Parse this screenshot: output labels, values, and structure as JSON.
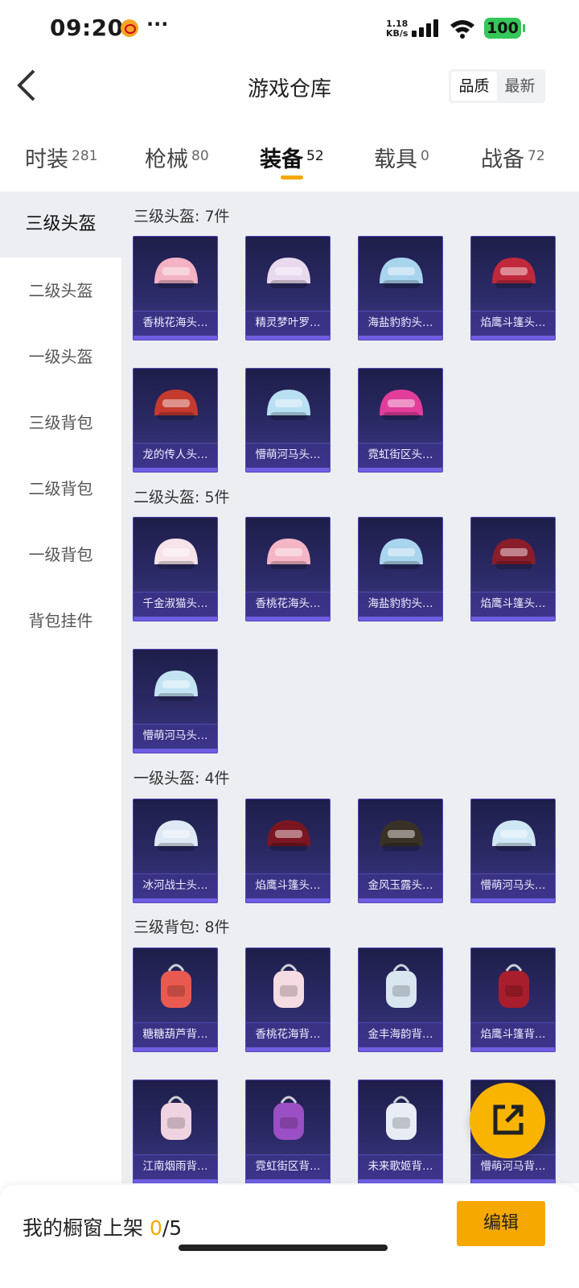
{
  "status_bar": {
    "time": "09:20",
    "more": "···",
    "net_speed_value": "1.18",
    "net_speed_unit": "KB/s",
    "battery": "100"
  },
  "header": {
    "title": "游戏仓库",
    "sort_quality": "品质",
    "sort_latest": "最新"
  },
  "tabs": [
    {
      "label": "时装",
      "count": "281"
    },
    {
      "label": "枪械",
      "count": "80"
    },
    {
      "label": "装备",
      "count": "52"
    },
    {
      "label": "载具",
      "count": "0"
    },
    {
      "label": "战备",
      "count": "72"
    }
  ],
  "sidebar": {
    "items": [
      "三级头盔",
      "二级头盔",
      "一级头盔",
      "三级背包",
      "二级背包",
      "一级背包",
      "背包挂件"
    ]
  },
  "sections": [
    {
      "title": "三级头盔: 7件",
      "items": [
        "香桃花海头…",
        "精灵梦叶罗…",
        "海盐豹豹头…",
        "焰鹰斗篷头…",
        "龙的传人头…",
        "懵萌河马头…",
        "霓虹街区头…"
      ]
    },
    {
      "title": "二级头盔: 5件",
      "items": [
        "千金淑猫头…",
        "香桃花海头…",
        "海盐豹豹头…",
        "焰鹰斗篷头…",
        "懵萌河马头…"
      ]
    },
    {
      "title": "一级头盔: 4件",
      "items": [
        "冰河战士头…",
        "焰鹰斗篷头…",
        "金风玉露头…",
        "懵萌河马头…"
      ]
    },
    {
      "title": "三级背包: 8件",
      "items": [
        "糖糖葫芦背…",
        "香桃花海背…",
        "金丰海韵背…",
        "焰鹰斗篷背…",
        "江南烟雨背…",
        "霓虹街区背…",
        "未来歌姬背…",
        "懵萌河马背…"
      ]
    }
  ],
  "bottom": {
    "label": "我的橱窗上架",
    "current": "0",
    "total": "/5",
    "edit_label": "编辑"
  },
  "colors": {
    "accent": "#f5a800",
    "card_bg": "#2b2a66",
    "content_bg": "#eceef2"
  }
}
